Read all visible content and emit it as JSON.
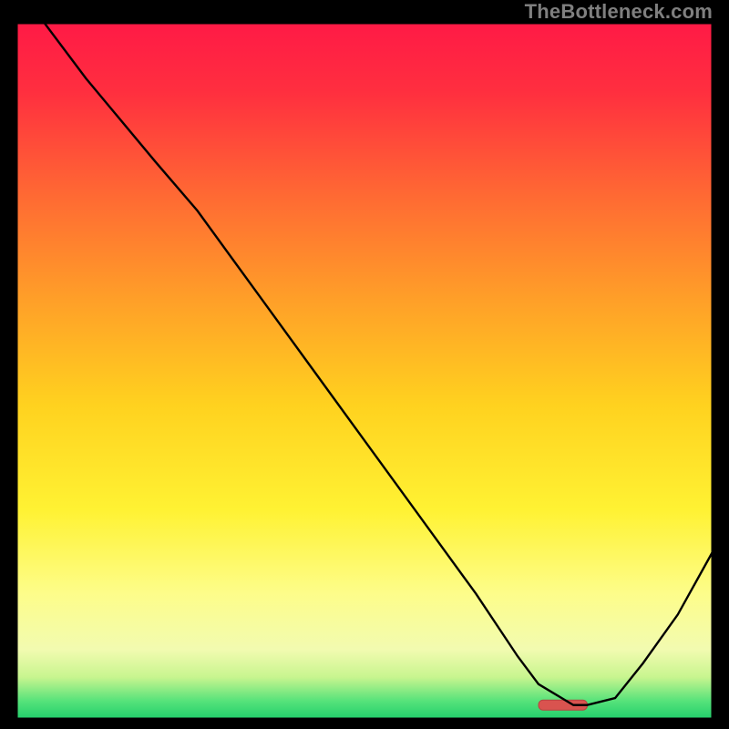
{
  "watermark": "TheBottleneck.com",
  "chart_data": {
    "type": "line",
    "title": "",
    "xlabel": "",
    "ylabel": "",
    "xlim": [
      0,
      100
    ],
    "ylim": [
      0,
      100
    ],
    "grid": false,
    "legend": false,
    "line": {
      "x": [
        4,
        10,
        20,
        26,
        34,
        42,
        50,
        58,
        66,
        72,
        75,
        80,
        82,
        86,
        90,
        95,
        100
      ],
      "y": [
        100,
        92,
        80,
        73,
        62,
        51,
        40,
        29,
        18,
        9,
        5,
        2,
        2,
        3,
        8,
        15,
        24
      ]
    },
    "markers": [
      {
        "x_start": 75,
        "x_end": 82,
        "y": 2,
        "color": "#d9534f"
      }
    ],
    "gradient_stops": [
      {
        "offset": 0.0,
        "color": "#ff1a46"
      },
      {
        "offset": 0.1,
        "color": "#ff2f3f"
      },
      {
        "offset": 0.25,
        "color": "#ff6a33"
      },
      {
        "offset": 0.4,
        "color": "#ffa028"
      },
      {
        "offset": 0.55,
        "color": "#ffd21f"
      },
      {
        "offset": 0.7,
        "color": "#fff233"
      },
      {
        "offset": 0.82,
        "color": "#fdfd8a"
      },
      {
        "offset": 0.9,
        "color": "#f2fbb0"
      },
      {
        "offset": 0.94,
        "color": "#c8f58f"
      },
      {
        "offset": 0.975,
        "color": "#54e27a"
      },
      {
        "offset": 1.0,
        "color": "#21cf6b"
      }
    ]
  }
}
